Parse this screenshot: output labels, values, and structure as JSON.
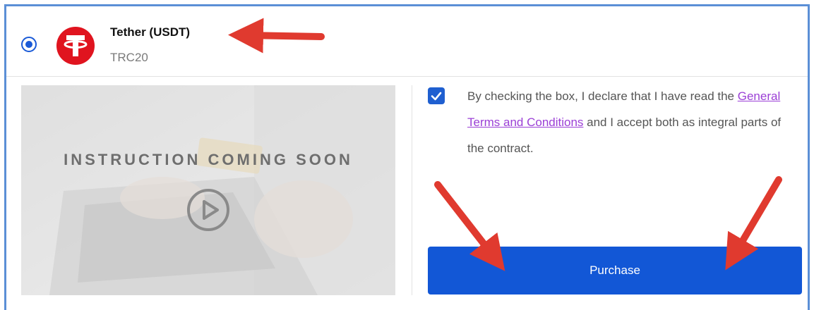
{
  "payment_option": {
    "name": "Tether (USDT)",
    "network": "TRC20",
    "selected": true,
    "logo_icon": "tether-logo-icon",
    "logo_color": "#e0141f"
  },
  "video": {
    "caption": "INSTRUCTION COMING SOON",
    "play_icon": "play-icon"
  },
  "terms": {
    "checked": true,
    "text_before": "By checking the box, I declare that I have read the",
    "link_text": "General Terms and Conditions",
    "text_after": " and I accept both as integral parts of the contract."
  },
  "actions": {
    "purchase_label": "Purchase"
  },
  "colors": {
    "accent": "#1257d6",
    "link": "#9b3fd6",
    "card_border": "#5b8fd6",
    "annotation_arrow": "#e03a2f"
  }
}
